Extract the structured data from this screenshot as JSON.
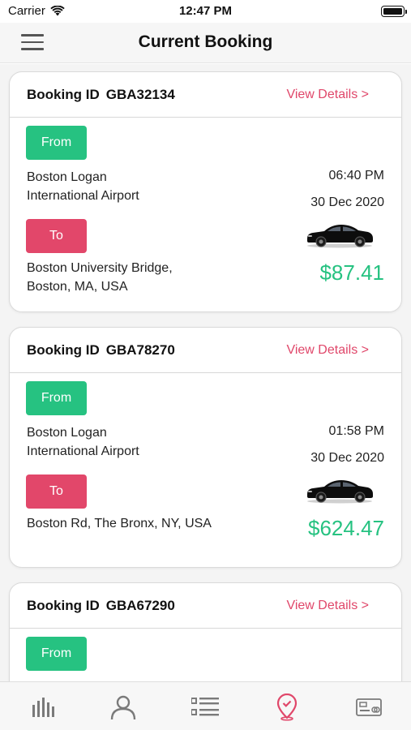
{
  "status_bar": {
    "carrier": "Carrier",
    "time": "12:47 PM"
  },
  "header": {
    "title": "Current Booking",
    "menu_icon": "hamburger-menu-icon"
  },
  "bookings": [
    {
      "id_label": "Booking ID",
      "id": "GBA32134",
      "view_details": "View Details >",
      "from_label": "From",
      "from_address_line1": "Boston Logan",
      "from_address_line2": "International Airport",
      "to_label": "To",
      "to_address_line1": "Boston University Bridge,",
      "to_address_line2": "Boston, MA, USA",
      "time": "06:40 PM",
      "date": "30 Dec 2020",
      "price": "$87.41"
    },
    {
      "id_label": "Booking ID",
      "id": "GBA78270",
      "view_details": "View Details >",
      "from_label": "From",
      "from_address_line1": "Boston Logan",
      "from_address_line2": "International Airport",
      "to_label": "To",
      "to_address_line1": "Boston Rd, The Bronx, NY, USA",
      "to_address_line2": "",
      "time": "01:58 PM",
      "date": "30 Dec 2020",
      "price": "$624.47"
    },
    {
      "id_label": "Booking ID",
      "id": "GBA67290",
      "view_details": "View Details >",
      "from_label": "From"
    }
  ],
  "tab_bar": {
    "items": [
      {
        "icon": "bar-chart-icon",
        "active": false
      },
      {
        "icon": "user-icon",
        "active": false
      },
      {
        "icon": "list-icon",
        "active": false
      },
      {
        "icon": "location-pin-icon",
        "active": true
      },
      {
        "icon": "card-icon",
        "active": false
      }
    ],
    "active_color": "#e0476a",
    "inactive_color": "#7a7a7a"
  },
  "colors": {
    "from_green": "#26c281",
    "to_red": "#e2476a",
    "link_pink": "#e0476a",
    "price_green": "#26c281"
  }
}
